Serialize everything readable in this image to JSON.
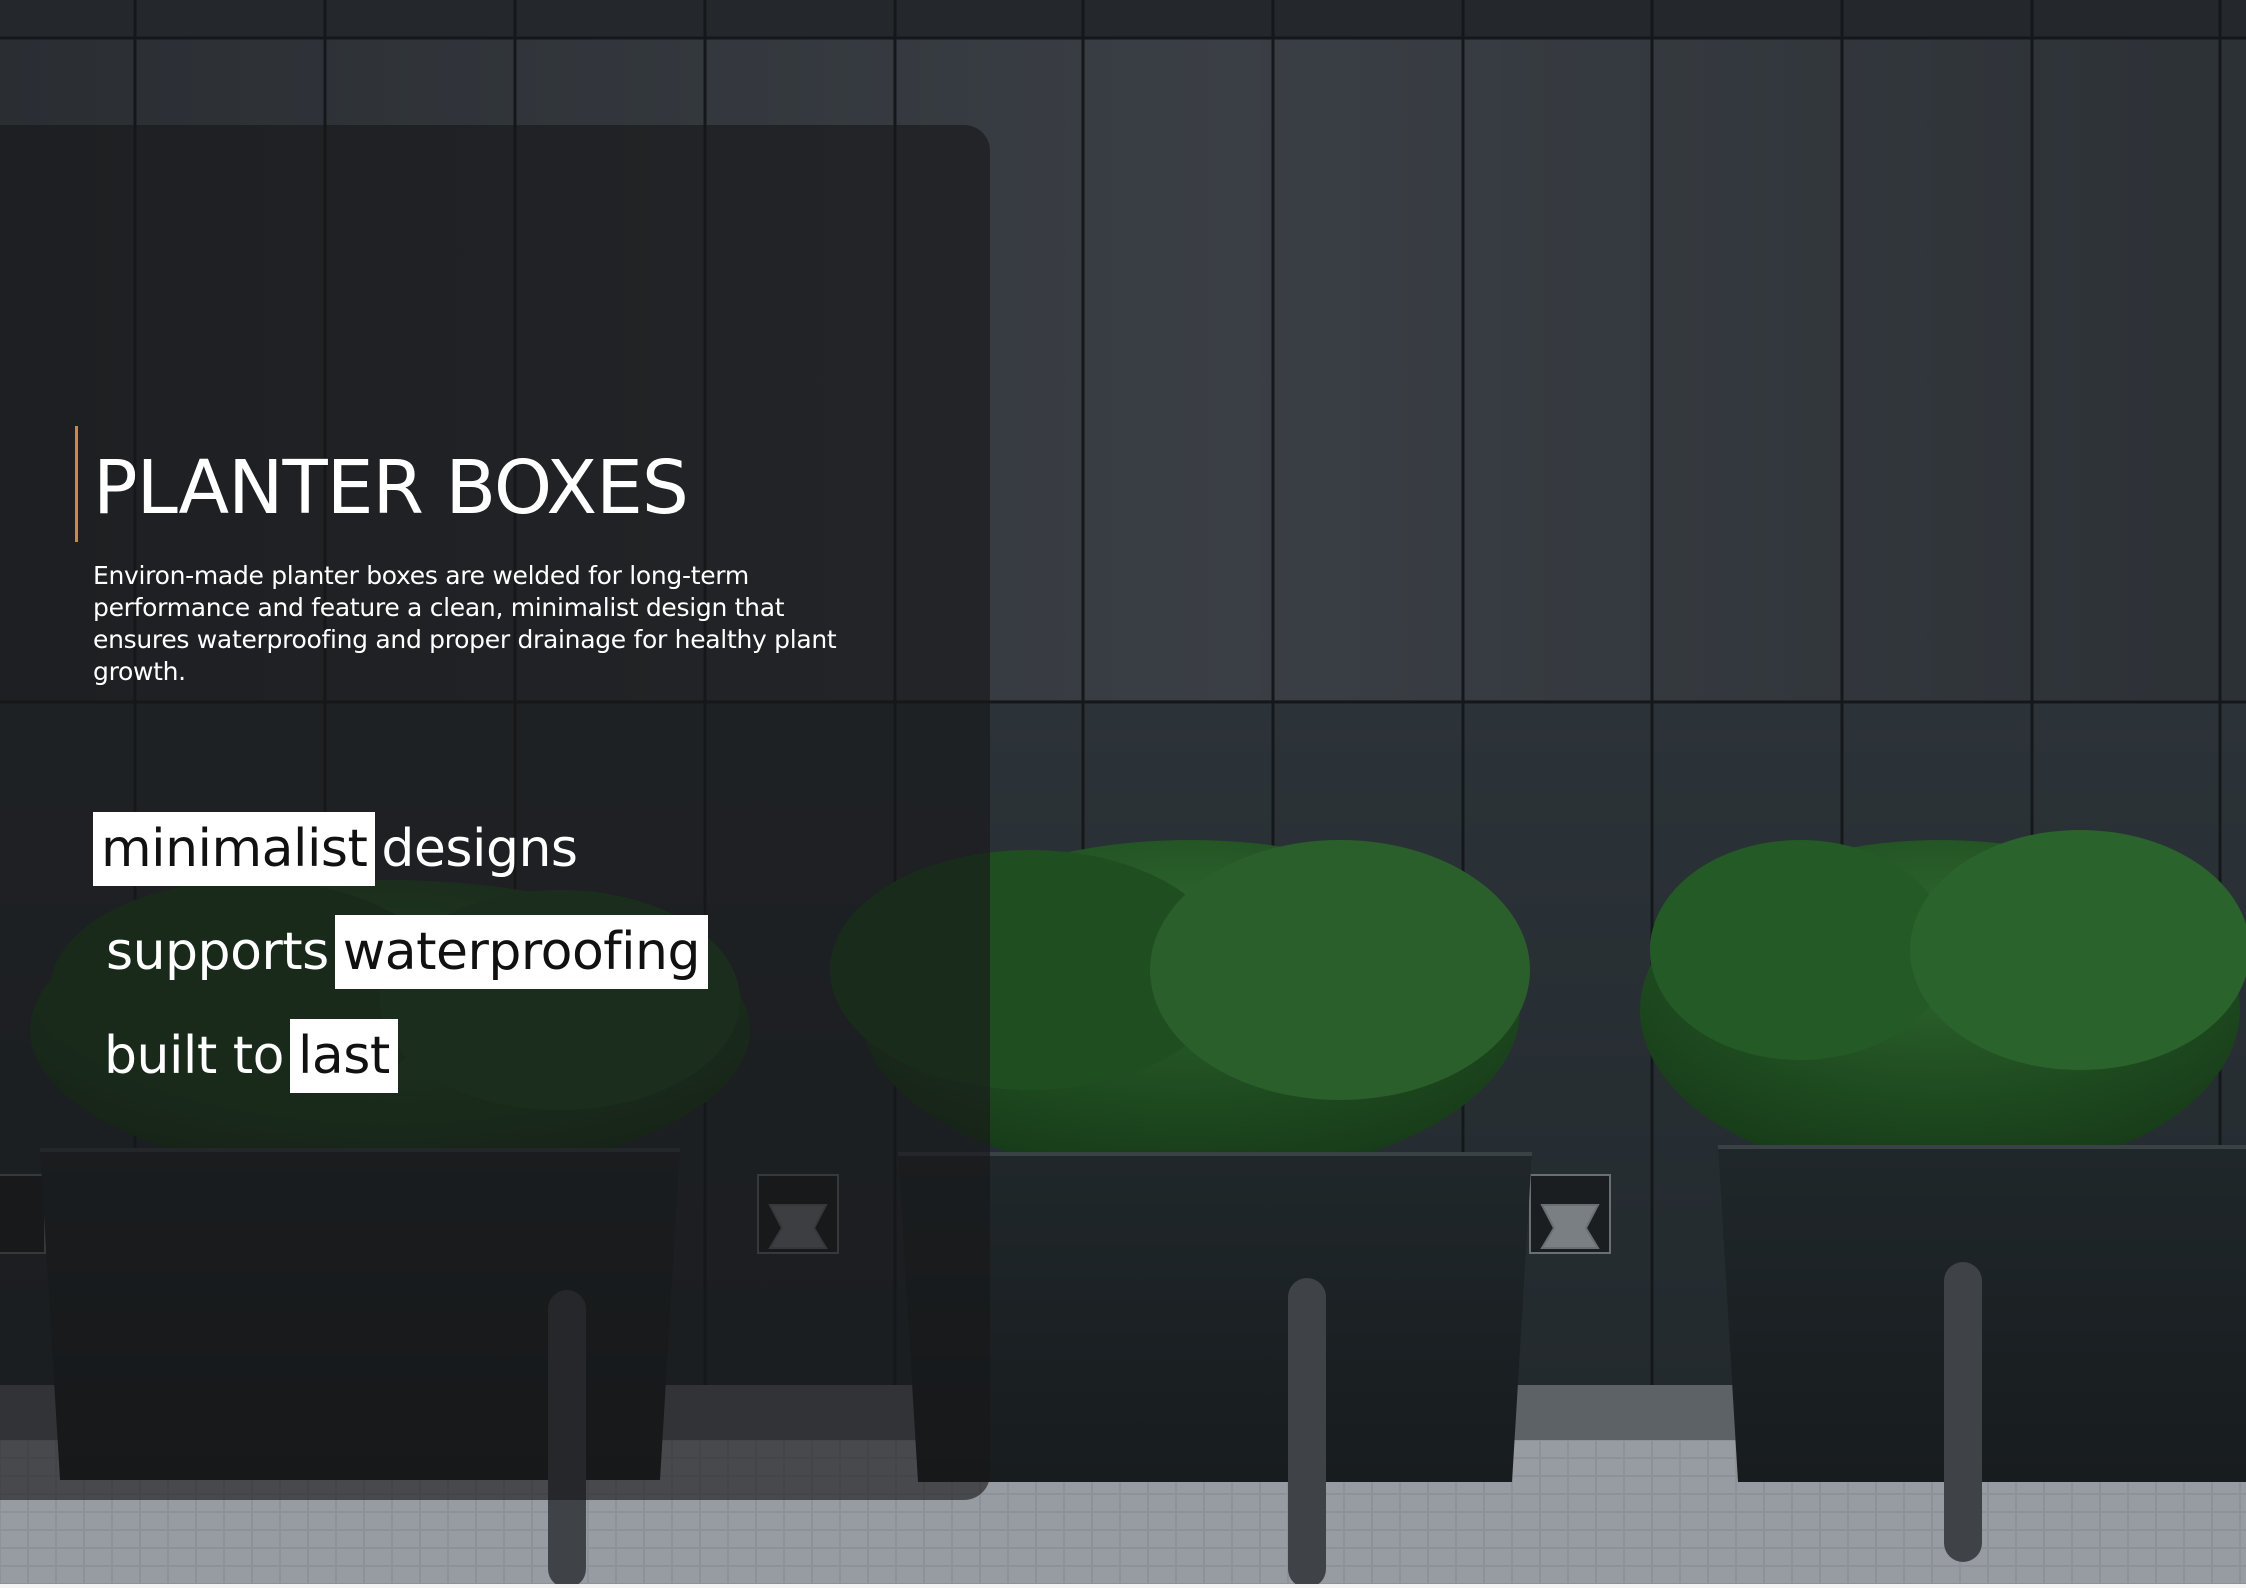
{
  "hero": {
    "title": "PLANTER BOXES",
    "description": "Environ-made planter boxes are welded for long-term performance and feature a clean, minimalist design that ensures waterproofing and proper drainage for healthy plant growth."
  },
  "taglines": [
    {
      "highlight": "minimalist",
      "text": "designs"
    },
    {
      "text": "supports",
      "highlight": "waterproofing"
    },
    {
      "text": "built to",
      "highlight": "last"
    }
  ],
  "colors": {
    "accent": "#c98a47",
    "wall": "#2e3338",
    "foliage": "#1f4a22",
    "planter": "#1c2124",
    "pavement": "#8b9096"
  }
}
